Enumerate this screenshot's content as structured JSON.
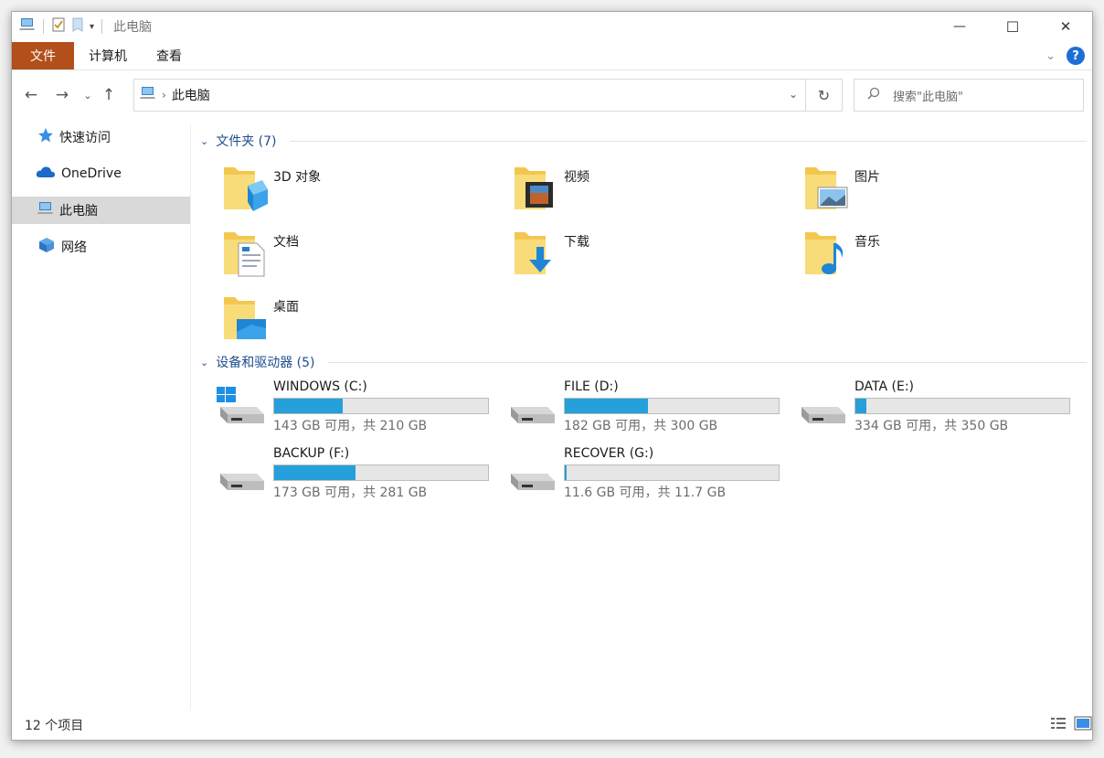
{
  "window": {
    "title": "此电脑"
  },
  "window_controls": {
    "minimize": "—",
    "maximize": "☐",
    "close": "✕"
  },
  "ribbon": {
    "tabs": [
      "文件",
      "计算机",
      "查看"
    ],
    "help": "?"
  },
  "nav": {
    "back": "←",
    "forward": "→",
    "recent": "⌄",
    "up": "↑",
    "breadcrumb": "此电脑",
    "refresh": "↻",
    "search_placeholder": "搜索\"此电脑\""
  },
  "sidebar": {
    "items": [
      {
        "label": "快速访问",
        "icon": "star-icon"
      },
      {
        "label": "OneDrive",
        "icon": "cloud-icon"
      },
      {
        "label": "此电脑",
        "icon": "computer-icon",
        "selected": true
      },
      {
        "label": "网络",
        "icon": "network-icon"
      }
    ]
  },
  "folders_group": {
    "title": "文件夹 (7)",
    "items": [
      {
        "label": "3D 对象",
        "icon": "3d-objects-folder-icon"
      },
      {
        "label": "视频",
        "icon": "videos-folder-icon"
      },
      {
        "label": "图片",
        "icon": "pictures-folder-icon"
      },
      {
        "label": "文档",
        "icon": "documents-folder-icon"
      },
      {
        "label": "下载",
        "icon": "downloads-folder-icon"
      },
      {
        "label": "音乐",
        "icon": "music-folder-icon"
      },
      {
        "label": "桌面",
        "icon": "desktop-folder-icon"
      }
    ]
  },
  "drives_group": {
    "title": "设备和驱动器 (5)",
    "items": [
      {
        "label": "WINDOWS (C:)",
        "info": "143 GB 可用，共 210 GB",
        "used_fraction": 0.32,
        "icon": "windows-drive-icon"
      },
      {
        "label": "FILE (D:)",
        "info": "182 GB 可用，共 300 GB",
        "used_fraction": 0.39,
        "icon": "drive-icon"
      },
      {
        "label": "DATA (E:)",
        "info": "334 GB 可用，共 350 GB",
        "used_fraction": 0.05,
        "icon": "drive-icon"
      },
      {
        "label": "BACKUP (F:)",
        "info": "173 GB 可用，共 281 GB",
        "used_fraction": 0.38,
        "icon": "drive-icon"
      },
      {
        "label": "RECOVER (G:)",
        "info": "11.6 GB 可用，共 11.7 GB",
        "used_fraction": 0.01,
        "icon": "drive-icon"
      }
    ]
  },
  "status": {
    "item_count": "12 个项目"
  },
  "colors": {
    "file_tab": "#b34f1b",
    "accent": "#26a0da",
    "group_title": "#1e4e8c"
  }
}
